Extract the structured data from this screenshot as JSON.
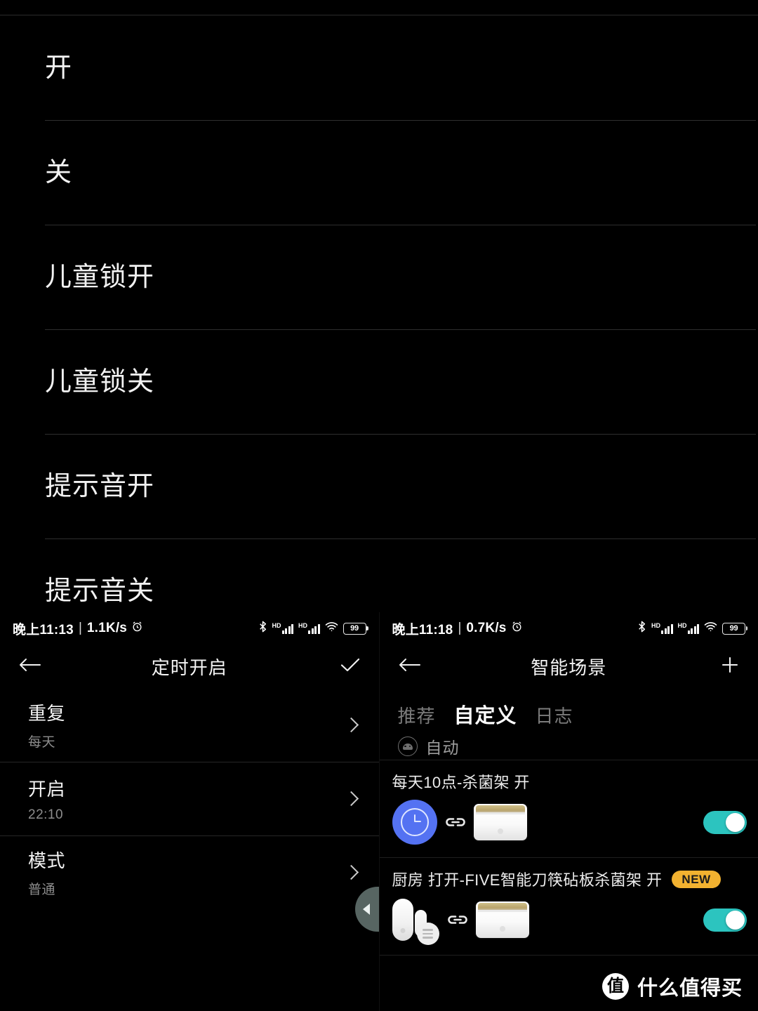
{
  "theme": {
    "background": "#000000",
    "accent_toggle": "#2cc4bf",
    "accent_clock_bubble": "#5472f2",
    "badge_new": "#f2b230",
    "divider": "#2b2b2b",
    "text_primary": "#f2f2f2",
    "text_secondary": "#8d8d8d",
    "handle": "#788c88"
  },
  "option_list": {
    "items": [
      {
        "label": "开"
      },
      {
        "label": "关"
      },
      {
        "label": "儿童锁开"
      },
      {
        "label": "儿童锁关"
      },
      {
        "label": "提示音开"
      },
      {
        "label": "提示音关"
      }
    ]
  },
  "left_pane": {
    "status_bar": {
      "time": "晚上11:13",
      "separator": "|",
      "net_speed": "1.1K/s",
      "alarm_icon": "alarm-clock-icon",
      "bluetooth_icon": "bluetooth-icon",
      "hd_label": "HD",
      "signal_icon": "signal-bars-icon",
      "wifi_icon": "wifi-icon",
      "battery_level": "99"
    },
    "app_bar": {
      "back_icon": "back-arrow-icon",
      "title": "定时开启",
      "confirm_icon": "check-icon"
    },
    "settings": [
      {
        "title": "重复",
        "value": "每天",
        "chevron": "chevron-right-icon"
      },
      {
        "title": "开启",
        "value": "22:10",
        "chevron": "chevron-right-icon"
      },
      {
        "title": "模式",
        "value": "普通",
        "chevron": "chevron-right-icon"
      }
    ],
    "edge_handle": {
      "icon": "triangle-left-icon"
    }
  },
  "right_pane": {
    "status_bar": {
      "time": "晚上11:18",
      "separator": "|",
      "net_speed": "0.7K/s",
      "alarm_icon": "alarm-clock-icon",
      "bluetooth_icon": "bluetooth-icon",
      "hd_label": "HD",
      "signal_icon": "signal-bars-icon",
      "wifi_icon": "wifi-icon",
      "battery_level": "99"
    },
    "app_bar": {
      "back_icon": "back-arrow-icon",
      "title": "智能场景",
      "add_icon": "plus-icon"
    },
    "tabs": [
      {
        "label": "推荐",
        "active": false
      },
      {
        "label": "自定义",
        "active": true
      },
      {
        "label": "日志",
        "active": false
      }
    ],
    "section": {
      "icon": "robot-icon",
      "title": "自动"
    },
    "scenes": [
      {
        "title": "每天10点-杀菌架 开",
        "badge": "",
        "trigger_icon": "clock-icon",
        "link_icon": "link-chain-icon",
        "device_icon": "sterilizer-rack-icon",
        "enabled": true
      },
      {
        "title": "厨房 打开-FIVE智能刀筷砧板杀菌架 开",
        "badge": "NEW",
        "trigger_icon": "door-sensor-icon",
        "extra_icon": "list-badge-icon",
        "link_icon": "link-chain-icon",
        "device_icon": "sterilizer-rack-icon",
        "enabled": true
      }
    ]
  },
  "watermark": {
    "mark": "值",
    "text": "什么值得买"
  }
}
